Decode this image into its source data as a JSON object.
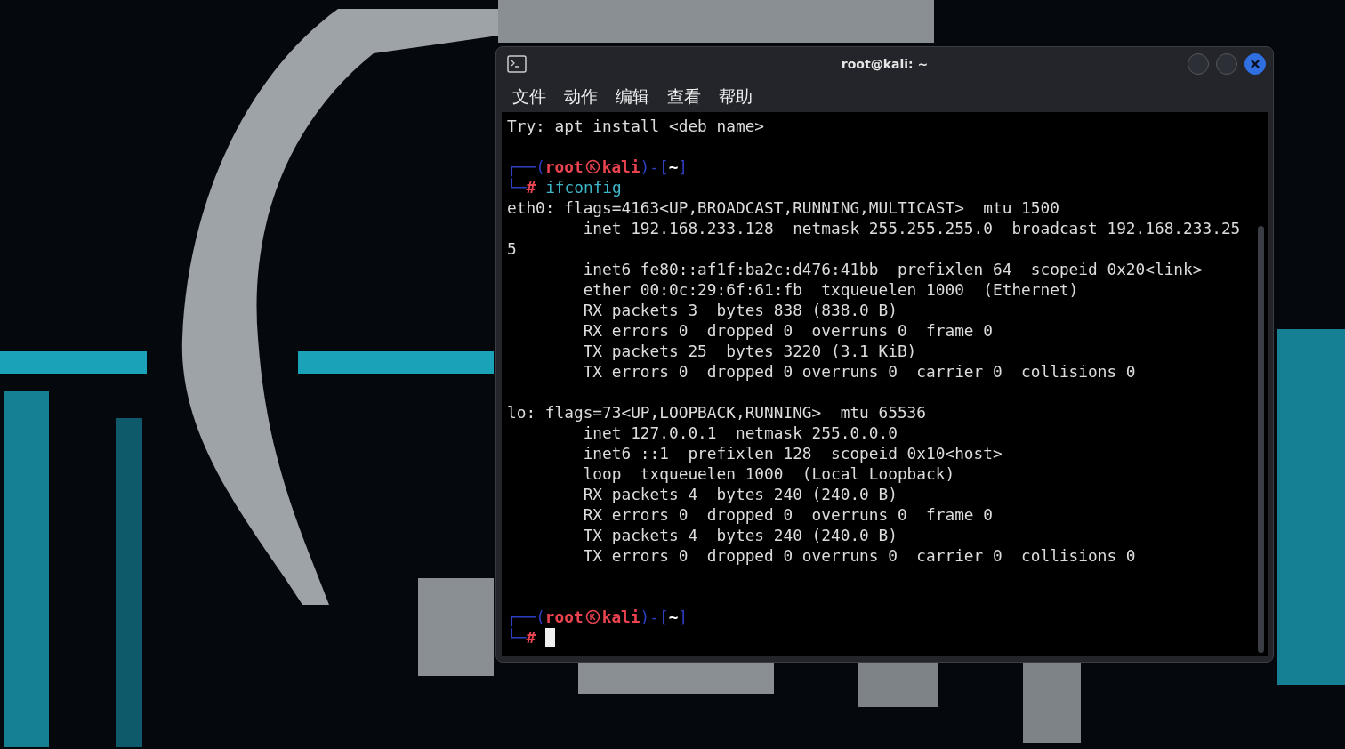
{
  "window": {
    "title": "root@kali: ~"
  },
  "menu": [
    "文件",
    "动作",
    "编辑",
    "查看",
    "帮助"
  ],
  "terminal": {
    "lines": [
      {
        "kind": "text",
        "text": "Try: apt install <deb name>"
      },
      {
        "kind": "blank"
      },
      {
        "kind": "prompt",
        "top": "┌──",
        "open": "(",
        "user": "root",
        "host": "kali",
        "mid": ")-[",
        "dir": "~",
        "close": "]",
        "bottom": "└─",
        "hash": "#",
        "command": "ifconfig",
        "cursor": false
      },
      {
        "kind": "text",
        "text": "eth0: flags=4163<UP,BROADCAST,RUNNING,MULTICAST>  mtu 1500"
      },
      {
        "kind": "text",
        "text": "        inet 192.168.233.128  netmask 255.255.255.0  broadcast 192.168.233.25"
      },
      {
        "kind": "text",
        "text": "5"
      },
      {
        "kind": "text",
        "text": "        inet6 fe80::af1f:ba2c:d476:41bb  prefixlen 64  scopeid 0x20<link>"
      },
      {
        "kind": "text",
        "text": "        ether 00:0c:29:6f:61:fb  txqueuelen 1000  (Ethernet)"
      },
      {
        "kind": "text",
        "text": "        RX packets 3  bytes 838 (838.0 B)"
      },
      {
        "kind": "text",
        "text": "        RX errors 0  dropped 0  overruns 0  frame 0"
      },
      {
        "kind": "text",
        "text": "        TX packets 25  bytes 3220 (3.1 KiB)"
      },
      {
        "kind": "text",
        "text": "        TX errors 0  dropped 0 overruns 0  carrier 0  collisions 0"
      },
      {
        "kind": "blank"
      },
      {
        "kind": "text",
        "text": "lo: flags=73<UP,LOOPBACK,RUNNING>  mtu 65536"
      },
      {
        "kind": "text",
        "text": "        inet 127.0.0.1  netmask 255.0.0.0"
      },
      {
        "kind": "text",
        "text": "        inet6 ::1  prefixlen 128  scopeid 0x10<host>"
      },
      {
        "kind": "text",
        "text": "        loop  txqueuelen 1000  (Local Loopback)"
      },
      {
        "kind": "text",
        "text": "        RX packets 4  bytes 240 (240.0 B)"
      },
      {
        "kind": "text",
        "text": "        RX errors 0  dropped 0  overruns 0  frame 0"
      },
      {
        "kind": "text",
        "text": "        TX packets 4  bytes 240 (240.0 B)"
      },
      {
        "kind": "text",
        "text": "        TX errors 0  dropped 0 overruns 0  carrier 0  collisions 0"
      },
      {
        "kind": "blank"
      },
      {
        "kind": "blank"
      },
      {
        "kind": "prompt",
        "top": "┌──",
        "open": "(",
        "user": "root",
        "host": "kali",
        "mid": ")-[",
        "dir": "~",
        "close": "]",
        "bottom": "└─",
        "hash": "#",
        "cursor": true
      }
    ]
  }
}
